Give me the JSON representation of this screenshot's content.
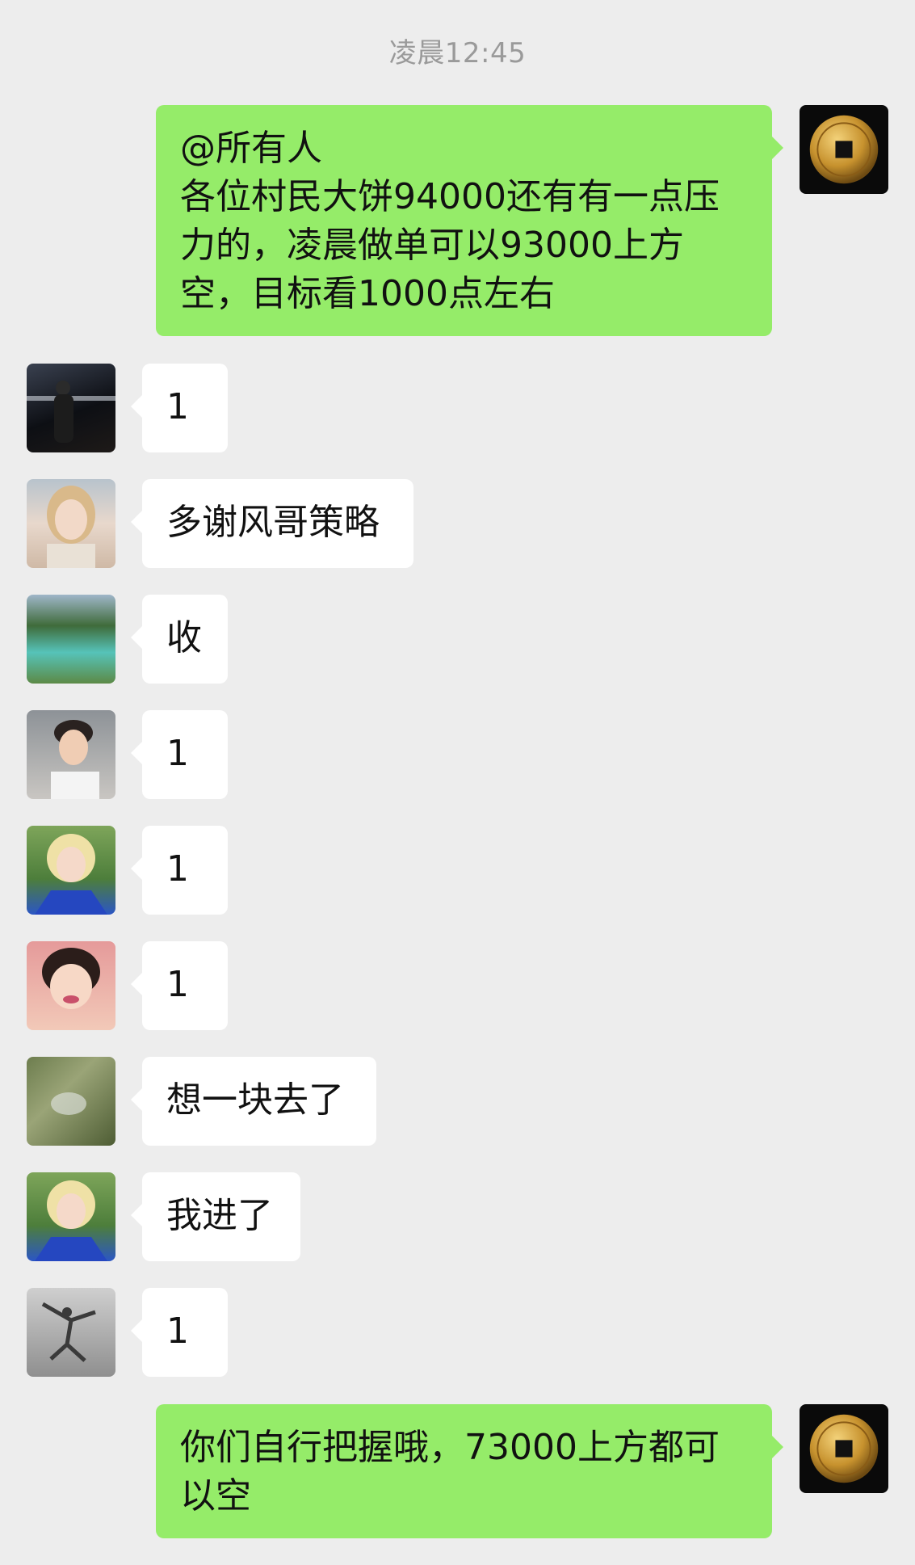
{
  "timestamp": "凌晨12:45",
  "messages": [
    {
      "side": "right",
      "text": "@所有人\n各位村民大饼94000还有有一点压力的，凌晨做单可以93000上方空，目标看1000点左右",
      "avatar": "gold-coin-icon"
    },
    {
      "side": "left",
      "text": "1",
      "avatar": "night-city-avatar"
    },
    {
      "side": "left",
      "text": "多谢风哥策略",
      "avatar": "woman-portrait-avatar"
    },
    {
      "side": "left",
      "text": "收",
      "avatar": "lake-landscape-avatar"
    },
    {
      "side": "left",
      "text": "1",
      "avatar": "man-portrait-avatar"
    },
    {
      "side": "left",
      "text": "1",
      "avatar": "blonde-girl-avatar"
    },
    {
      "side": "left",
      "text": "1",
      "avatar": "child-portrait-avatar"
    },
    {
      "side": "left",
      "text": "想一块去了",
      "avatar": "grass-field-avatar"
    },
    {
      "side": "left",
      "text": "我进了",
      "avatar": "blonde-girl-avatar"
    },
    {
      "side": "left",
      "text": "1",
      "avatar": "dancer-bw-avatar"
    },
    {
      "side": "right",
      "text": "你们自行把握哦，73000上方都可以空",
      "avatar": "gold-coin-icon"
    }
  ],
  "colors": {
    "background": "#ededed",
    "bubble_self": "#95ec69",
    "bubble_other": "#ffffff",
    "timestamp": "#9a9a9a"
  }
}
